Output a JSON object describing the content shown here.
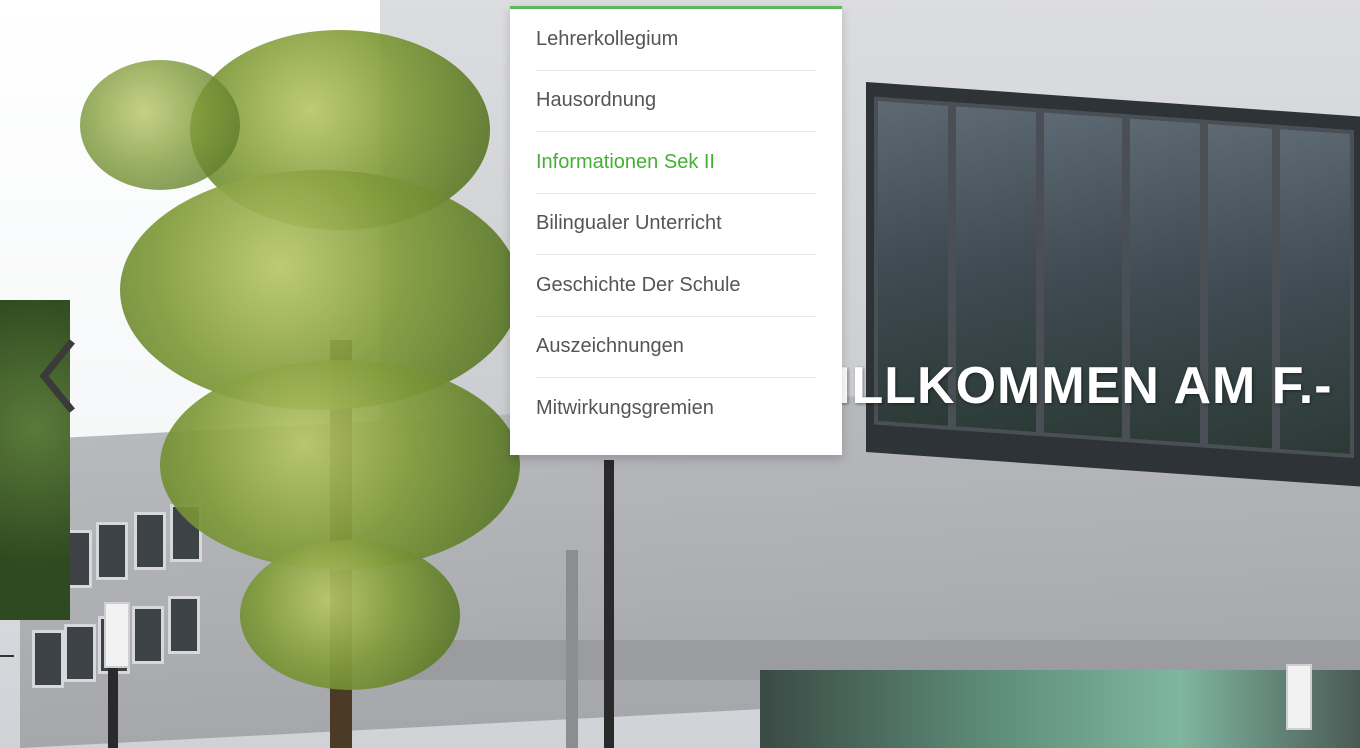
{
  "hero": {
    "title": "WILLKOMMEN AM F.-"
  },
  "slider": {
    "prev_icon": "chevron-left-icon"
  },
  "dropdown": {
    "accent_color": "#5cb85c",
    "active_color": "#45b035",
    "items": [
      {
        "label": "Lehrerkollegium"
      },
      {
        "label": "Hausordnung"
      },
      {
        "label": "Informationen Sek II"
      },
      {
        "label": "Bilingualer Unterricht"
      },
      {
        "label": "Geschichte Der Schule"
      },
      {
        "label": "Auszeichnungen"
      },
      {
        "label": "Mitwirkungsgremien"
      }
    ]
  }
}
